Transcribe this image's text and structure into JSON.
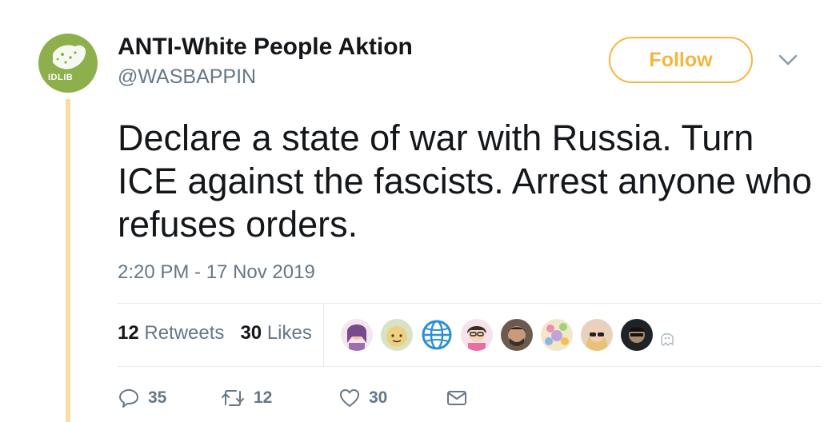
{
  "tweet": {
    "avatar_text": "IDLIB",
    "display_name": "ANTI-White People Aktion",
    "handle": "@WASBAPPIN",
    "follow_label": "Follow",
    "text": "Declare a state of war with Russia. Turn ICE against the fascists. Arrest anyone who refuses orders.",
    "timestamp": "2:20 PM - 17 Nov 2019",
    "stats": {
      "retweets_count": "12",
      "retweets_label": "Retweets",
      "likes_count": "30",
      "likes_label": "Likes"
    },
    "actions": {
      "reply_count": "35",
      "retweet_count": "12",
      "like_count": "30"
    },
    "colors": {
      "accent": "#f5b53f",
      "thread_line": "#fbdca0",
      "avatar_bg": "#8db04d",
      "text": "#14171a",
      "muted": "#657786"
    },
    "liker_avatars": [
      "liker-avatar",
      "liker-avatar",
      "liker-avatar",
      "liker-avatar",
      "liker-avatar",
      "liker-avatar",
      "liker-avatar",
      "liker-avatar"
    ]
  }
}
